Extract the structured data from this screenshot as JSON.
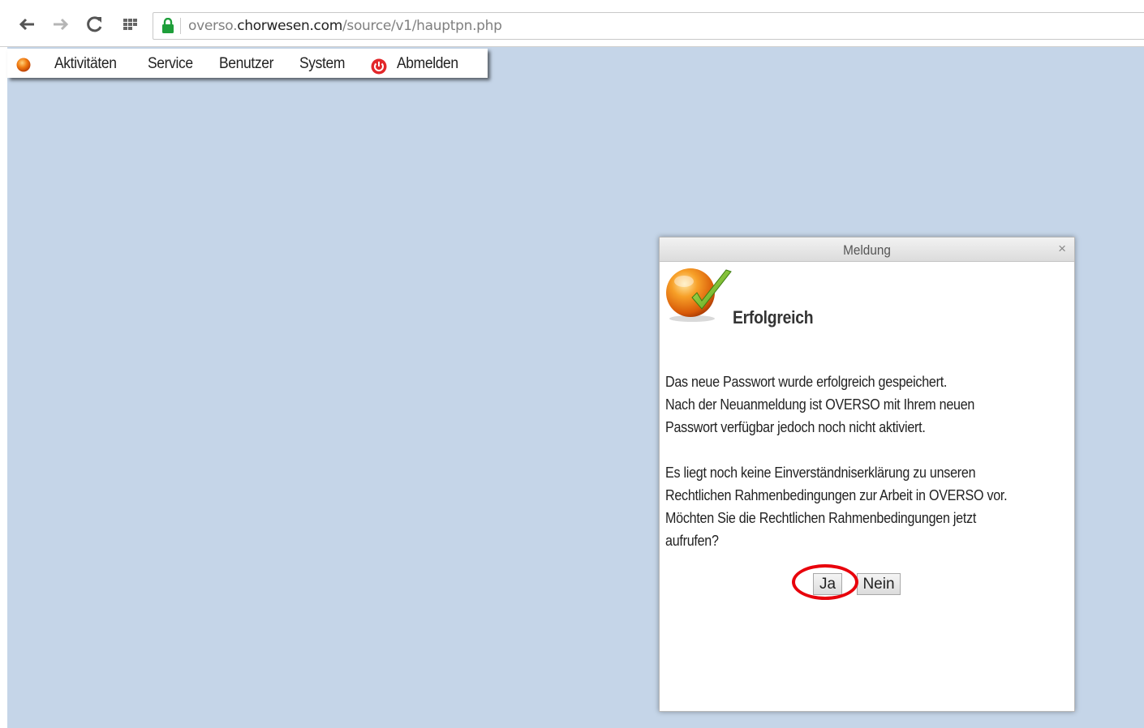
{
  "browser": {
    "url_prefix": "overso.",
    "url_domain": "chorwesen.com",
    "url_path": "/source/v1/hauptpn.php"
  },
  "menu": {
    "items": [
      "Aktivitäten",
      "Service",
      "Benutzer",
      "System"
    ],
    "logout_label": "Abmelden"
  },
  "dialog": {
    "title": "Meldung",
    "close_glyph": "×",
    "heading": "Erfolgreich",
    "paragraph1": [
      "Das neue Passwort wurde erfolgreich gespeichert.",
      "Nach der Neuanmeldung ist OVERSO mit Ihrem neuen",
      "Passwort verfügbar jedoch noch nicht aktiviert."
    ],
    "paragraph2": [
      "Es liegt noch keine Einverständniserklärung zu unseren",
      "Rechtlichen Rahmenbedingungen zur Arbeit in OVERSO vor.",
      "Möchten Sie die Rechtlichen Rahmenbedingungen jetzt",
      "aufrufen?"
    ],
    "yes_label": "Ja",
    "no_label": "Nein"
  },
  "colors": {
    "app_background": "#c5d5e8",
    "highlight_ring": "#e8000b",
    "brand_orange": "#f07a10",
    "check_green": "#7cc42a"
  },
  "icons": [
    "back-arrow-icon",
    "forward-arrow-icon",
    "reload-icon",
    "apps-grid-icon",
    "lock-icon",
    "overso-logo-icon",
    "power-icon",
    "close-icon",
    "success-check-icon"
  ]
}
